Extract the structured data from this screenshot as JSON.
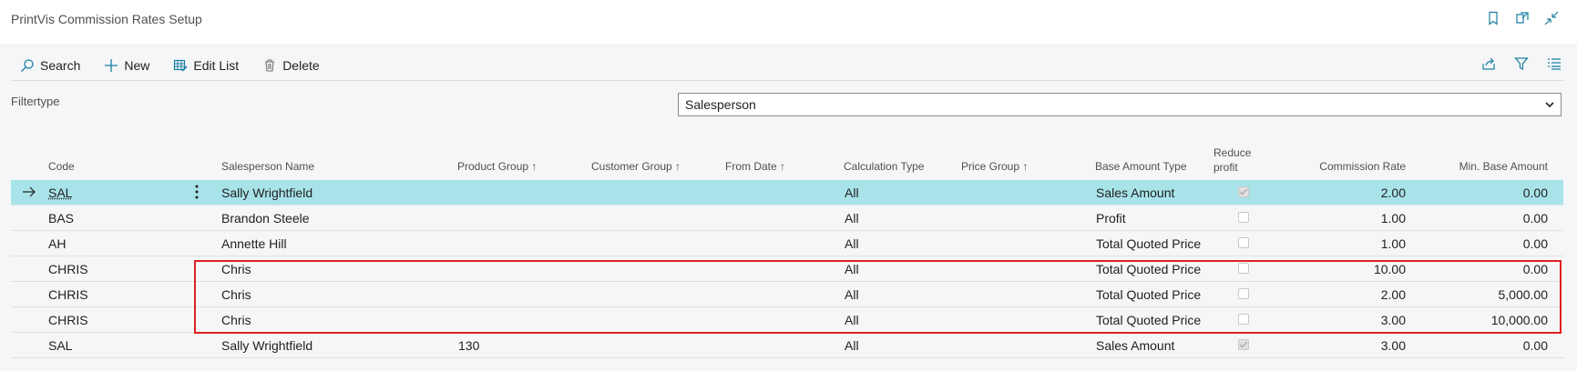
{
  "page": {
    "title": "PrintVis Commission Rates Setup"
  },
  "toolbar": {
    "search_label": "Search",
    "new_label": "New",
    "edit_list_label": "Edit List",
    "delete_label": "Delete"
  },
  "filter": {
    "label": "Filtertype",
    "selected": "Salesperson"
  },
  "columns": {
    "code": "Code",
    "salesperson_name": "Salesperson Name",
    "product_group": "Product Group ↑",
    "customer_group": "Customer Group ↑",
    "from_date": "From Date ↑",
    "calculation_type": "Calculation Type",
    "price_group": "Price Group ↑",
    "base_amount_type": "Base Amount Type",
    "reduce_profit_line1": "Reduce",
    "reduce_profit_line2": "profit",
    "commission_rate": "Commission Rate",
    "min_base_amount": "Min. Base Amount"
  },
  "rows": [
    {
      "code": "SAL",
      "salesperson_name": "Sally Wrightfield",
      "product_group": "",
      "calculation_type": "All",
      "base_amount_type": "Sales Amount",
      "reduce_profit": true,
      "commission_rate": "2.00",
      "min_base_amount": "0.00",
      "selected": true
    },
    {
      "code": "BAS",
      "salesperson_name": "Brandon Steele",
      "product_group": "",
      "calculation_type": "All",
      "base_amount_type": "Profit",
      "reduce_profit": false,
      "commission_rate": "1.00",
      "min_base_amount": "0.00",
      "selected": false
    },
    {
      "code": "AH",
      "salesperson_name": "Annette Hill",
      "product_group": "",
      "calculation_type": "All",
      "base_amount_type": "Total Quoted Price",
      "reduce_profit": false,
      "commission_rate": "1.00",
      "min_base_amount": "0.00",
      "selected": false
    },
    {
      "code": "CHRIS",
      "salesperson_name": "Chris",
      "product_group": "",
      "calculation_type": "All",
      "base_amount_type": "Total Quoted Price",
      "reduce_profit": false,
      "commission_rate": "10.00",
      "min_base_amount": "0.00",
      "selected": false
    },
    {
      "code": "CHRIS",
      "salesperson_name": "Chris",
      "product_group": "",
      "calculation_type": "All",
      "base_amount_type": "Total Quoted Price",
      "reduce_profit": false,
      "commission_rate": "2.00",
      "min_base_amount": "5,000.00",
      "selected": false
    },
    {
      "code": "CHRIS",
      "salesperson_name": "Chris",
      "product_group": "",
      "calculation_type": "All",
      "base_amount_type": "Total Quoted Price",
      "reduce_profit": false,
      "commission_rate": "3.00",
      "min_base_amount": "10,000.00",
      "selected": false
    },
    {
      "code": "SAL",
      "salesperson_name": "Sally Wrightfield",
      "product_group": "130",
      "calculation_type": "All",
      "base_amount_type": "Sales Amount",
      "reduce_profit": true,
      "commission_rate": "3.00",
      "min_base_amount": "0.00",
      "selected": false
    }
  ],
  "colors": {
    "accent": "#1a7fa0",
    "selected_row": "#a8e3ea",
    "highlight_border": "#e02020"
  }
}
